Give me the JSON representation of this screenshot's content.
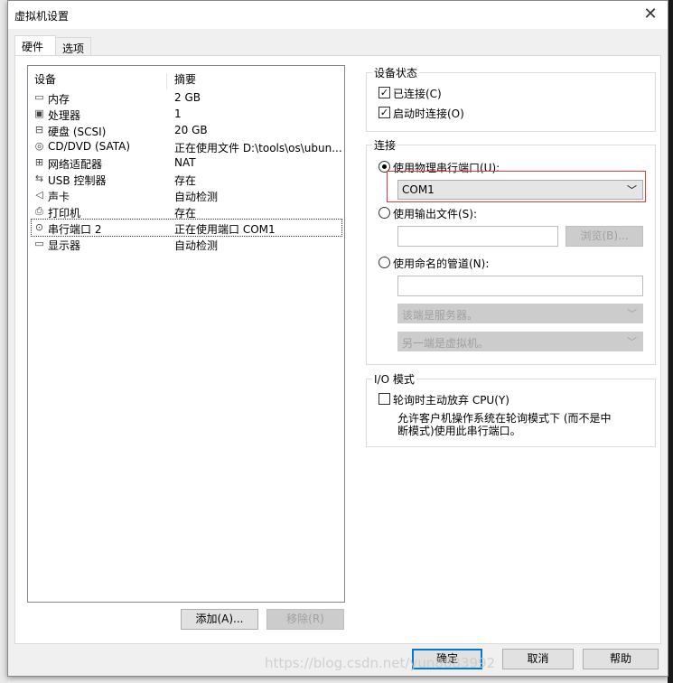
{
  "window": {
    "title": "虚拟机设置",
    "close_icon": "close-icon"
  },
  "tabs": [
    {
      "label": "硬件",
      "active": true
    },
    {
      "label": "选项",
      "active": false
    }
  ],
  "device_list": {
    "headers": [
      "设备",
      "摘要"
    ],
    "rows": [
      {
        "icon": "memory-icon",
        "name": "内存",
        "summary": "2 GB"
      },
      {
        "icon": "processor-icon",
        "name": "处理器",
        "summary": "1"
      },
      {
        "icon": "hard-disk-icon",
        "name": "硬盘 (SCSI)",
        "summary": "20 GB"
      },
      {
        "icon": "cd-dvd-icon",
        "name": "CD/DVD (SATA)",
        "summary": "正在使用文件 D:\\tools\\os\\ubun..."
      },
      {
        "icon": "network-adapter-icon",
        "name": "网络适配器",
        "summary": "NAT"
      },
      {
        "icon": "usb-icon",
        "name": "USB 控制器",
        "summary": "存在"
      },
      {
        "icon": "sound-card-icon",
        "name": "声卡",
        "summary": "自动检测"
      },
      {
        "icon": "printer-icon",
        "name": "打印机",
        "summary": "存在"
      },
      {
        "icon": "serial-port-icon",
        "name": "串行端口 2",
        "summary": "正在使用端口 COM1",
        "selected": true
      },
      {
        "icon": "display-icon",
        "name": "显示器",
        "summary": "自动检测"
      }
    ],
    "add_label": "添加(A)...",
    "remove_label": "移除(R)"
  },
  "device_status": {
    "legend": "设备状态",
    "connected": {
      "label": "已连接(C)",
      "checked": true
    },
    "connect_at_power_on": {
      "label": "启动时连接(O)",
      "checked": true
    }
  },
  "connection": {
    "legend": "连接",
    "physical": {
      "label": "使用物理串行端口(U):",
      "selected": true,
      "value": "COM1"
    },
    "output_file": {
      "label": "使用输出文件(S):",
      "selected": false,
      "value": "",
      "browse_label": "浏览(B)..."
    },
    "named_pipe": {
      "label": "使用命名的管道(N):",
      "selected": false,
      "value": "",
      "end_select": "该端是服务器。",
      "other_end_select": "另一端是虚拟机。"
    }
  },
  "io_mode": {
    "legend": "I/O 模式",
    "yield_cpu": {
      "label": "轮询时主动放弃 CPU(Y)",
      "checked": false
    },
    "description": "允许客户机操作系统在轮询模式下 (而不是中断模式)使用此串行端口。"
  },
  "footer": {
    "ok": "确定",
    "cancel": "取消",
    "help": "帮助"
  },
  "watermark": "https://blog.csdn.net/yun8883992",
  "colors": {
    "accent": "#0078d7",
    "highlight": "#e53935"
  }
}
